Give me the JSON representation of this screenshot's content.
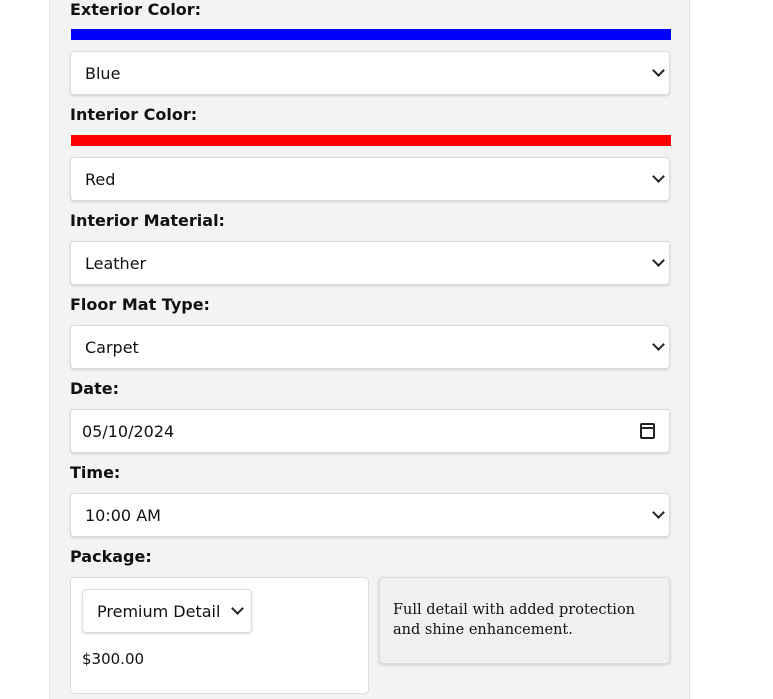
{
  "form": {
    "exterior_color": {
      "label": "Exterior Color:",
      "swatch_color": "#0000ff",
      "value": "Blue"
    },
    "interior_color": {
      "label": "Interior Color:",
      "swatch_color": "#ff0000",
      "value": "Red"
    },
    "interior_material": {
      "label": "Interior Material:",
      "value": "Leather"
    },
    "floor_mat_type": {
      "label": "Floor Mat Type:",
      "value": "Carpet"
    },
    "date": {
      "label": "Date:",
      "value": "05/10/2024"
    },
    "time": {
      "label": "Time:",
      "value": "10:00 AM"
    },
    "package": {
      "label": "Package:",
      "value": "Premium Detail",
      "price": "$300.00",
      "description": "Full detail with added protection and shine enhancement."
    }
  }
}
